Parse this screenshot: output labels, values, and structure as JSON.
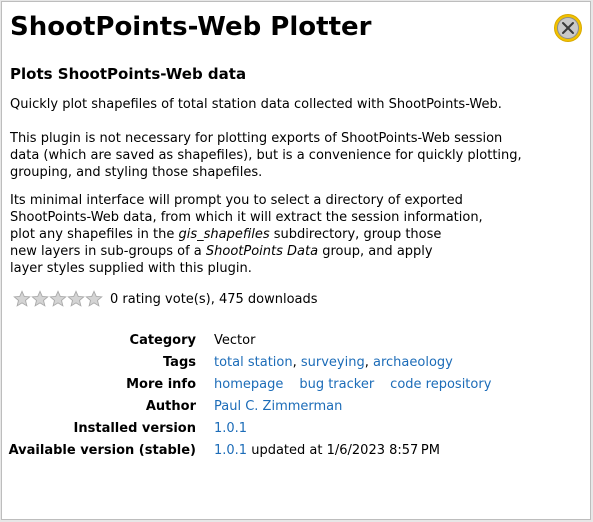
{
  "plugin": {
    "title": "ShootPoints-Web Plotter",
    "subtitle": "Plots ShootPoints-Web data",
    "description": {
      "p1": [
        "Quickly plot shapefiles of total station data collected with ShootPoints-Web."
      ],
      "p2": [
        "This plugin is not necessary for plotting exports of ShootPoints-Web session",
        "data (which are saved as shapefiles), but is a convenience for quickly plotting,",
        "grouping, and styling those shapefiles."
      ],
      "p3": {
        "line1": "Its minimal interface will prompt you to select a directory of exported",
        "line2": "ShootPoints-Web data, from which it will extract the session information,",
        "line3_a": "plot any shapefiles in the ",
        "line3_em": "gis_shapefiles",
        "line3_b": " subdirectory, group those",
        "line4_a": "new layers in sub-groups of a ",
        "line4_em": "ShootPoints Data",
        "line4_b": " group, and apply",
        "line5": "layer styles supplied with this plugin."
      }
    },
    "rating": {
      "stars_filled": 0,
      "stars_total": 5,
      "text": "0 rating vote(s), 475 downloads"
    },
    "meta": {
      "category_label": "Category",
      "category_value": "Vector",
      "tags_label": "Tags",
      "tag1": "total station",
      "tag2": "surveying",
      "tag3": "archaeology",
      "tag_sep": ", ",
      "moreinfo_label": "More info",
      "link_homepage": "homepage",
      "link_bugtracker": "bug tracker",
      "link_repo": "code repository",
      "author_label": "Author",
      "author_value": "Paul C. Zimmerman",
      "installed_label": "Installed version",
      "installed_value": "1.0.1",
      "available_label": "Available version (stable)",
      "available_value": "1.0.1",
      "available_updated": " updated at 1/6/2023 8:57 PM"
    }
  },
  "colors": {
    "link": "#1c6cb8",
    "close_icon_ring": "#f2c200"
  },
  "icons": {
    "close": "close-circle-icon",
    "star": "star-outline-icon"
  }
}
